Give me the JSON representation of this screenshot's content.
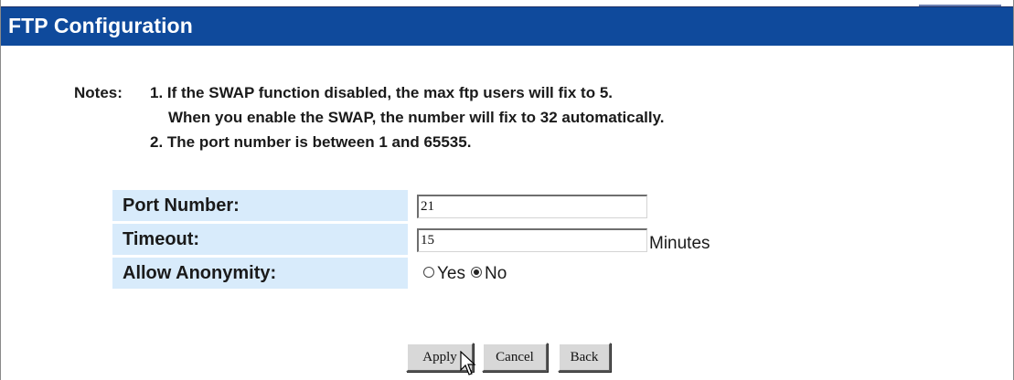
{
  "header": {
    "title": "FTP Configuration"
  },
  "notes": {
    "label": "Notes:",
    "line1": "1. If the SWAP function disabled, the max ftp users will fix to 5.",
    "line1_cont": "When you enable the SWAP, the number will fix to 32 automatically.",
    "line2": "2. The port number is between 1 and 65535."
  },
  "form": {
    "port": {
      "label": "Port Number:",
      "value": "21"
    },
    "timeout": {
      "label": "Timeout:",
      "value": "15",
      "unit": "Minutes"
    },
    "anonymity": {
      "label": "Allow Anonymity:",
      "options": [
        "Yes",
        "No"
      ],
      "selected": "No"
    }
  },
  "buttons": {
    "apply": "Apply",
    "cancel": "Cancel",
    "back": "Back"
  },
  "colors": {
    "header_bg": "#0f4a9c",
    "label_bg": "#d8ebfb"
  },
  "icons": {
    "cursor": "arrow-cursor-icon"
  }
}
